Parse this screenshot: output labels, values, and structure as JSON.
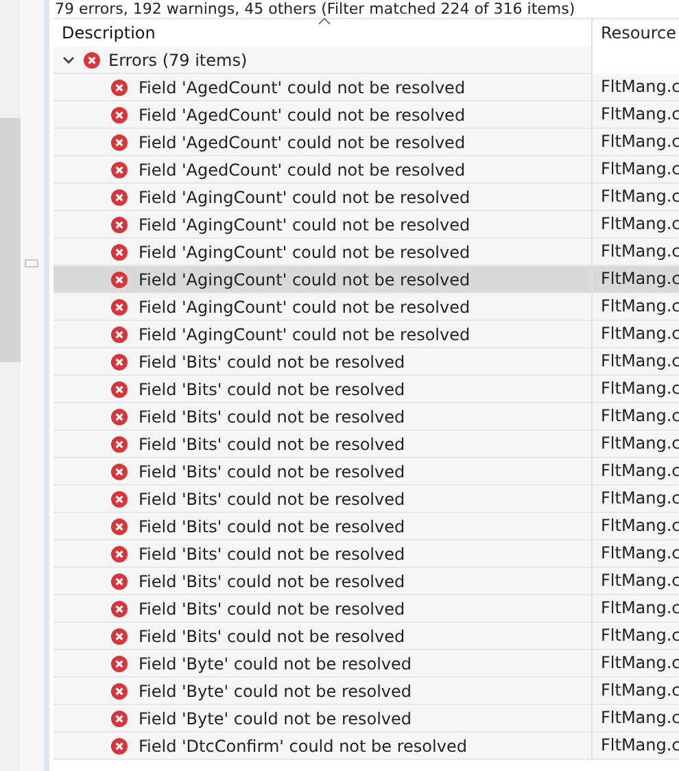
{
  "summary": "79 errors, 192 warnings, 45 others (Filter matched 224 of 316 items)",
  "columns": [
    {
      "label": "Description",
      "sorted": true
    },
    {
      "label": "Resource",
      "sorted": false
    }
  ],
  "groups": [
    {
      "label": "Errors (79 items)",
      "kind": "error",
      "expanded": true,
      "children": [
        {
          "description": "Field 'AgedCount' could not be resolved",
          "resource": "FltMang.c",
          "kind": "error",
          "selected": false
        },
        {
          "description": "Field 'AgedCount' could not be resolved",
          "resource": "FltMang.c",
          "kind": "error",
          "selected": false
        },
        {
          "description": "Field 'AgedCount' could not be resolved",
          "resource": "FltMang.c",
          "kind": "error",
          "selected": false
        },
        {
          "description": "Field 'AgedCount' could not be resolved",
          "resource": "FltMang.c",
          "kind": "error",
          "selected": false
        },
        {
          "description": "Field 'AgingCount' could not be resolved",
          "resource": "FltMang.c",
          "kind": "error",
          "selected": false
        },
        {
          "description": "Field 'AgingCount' could not be resolved",
          "resource": "FltMang.c",
          "kind": "error",
          "selected": false
        },
        {
          "description": "Field 'AgingCount' could not be resolved",
          "resource": "FltMang.c",
          "kind": "error",
          "selected": false
        },
        {
          "description": "Field 'AgingCount' could not be resolved",
          "resource": "FltMang.c",
          "kind": "error",
          "selected": true
        },
        {
          "description": "Field 'AgingCount' could not be resolved",
          "resource": "FltMang.c",
          "kind": "error",
          "selected": false
        },
        {
          "description": "Field 'AgingCount' could not be resolved",
          "resource": "FltMang.c",
          "kind": "error",
          "selected": false
        },
        {
          "description": "Field 'Bits' could not be resolved",
          "resource": "FltMang.c",
          "kind": "error",
          "selected": false
        },
        {
          "description": "Field 'Bits' could not be resolved",
          "resource": "FltMang.c",
          "kind": "error",
          "selected": false
        },
        {
          "description": "Field 'Bits' could not be resolved",
          "resource": "FltMang.c",
          "kind": "error",
          "selected": false
        },
        {
          "description": "Field 'Bits' could not be resolved",
          "resource": "FltMang.c",
          "kind": "error",
          "selected": false
        },
        {
          "description": "Field 'Bits' could not be resolved",
          "resource": "FltMang.c",
          "kind": "error",
          "selected": false
        },
        {
          "description": "Field 'Bits' could not be resolved",
          "resource": "FltMang.c",
          "kind": "error",
          "selected": false
        },
        {
          "description": "Field 'Bits' could not be resolved",
          "resource": "FltMang.c",
          "kind": "error",
          "selected": false
        },
        {
          "description": "Field 'Bits' could not be resolved",
          "resource": "FltMang.c",
          "kind": "error",
          "selected": false
        },
        {
          "description": "Field 'Bits' could not be resolved",
          "resource": "FltMang.c",
          "kind": "error",
          "selected": false
        },
        {
          "description": "Field 'Bits' could not be resolved",
          "resource": "FltMang.c",
          "kind": "error",
          "selected": false
        },
        {
          "description": "Field 'Bits' could not be resolved",
          "resource": "FltMang.c",
          "kind": "error",
          "selected": false
        },
        {
          "description": "Field 'Byte' could not be resolved",
          "resource": "FltMang.c",
          "kind": "error",
          "selected": false
        },
        {
          "description": "Field 'Byte' could not be resolved",
          "resource": "FltMang.c",
          "kind": "error",
          "selected": false
        },
        {
          "description": "Field 'Byte' could not be resolved",
          "resource": "FltMang.c",
          "kind": "error",
          "selected": false
        },
        {
          "description": "Field 'DtcConfirm' could not be resolved",
          "resource": "FltMang.c",
          "kind": "error",
          "selected": false
        }
      ]
    }
  ]
}
